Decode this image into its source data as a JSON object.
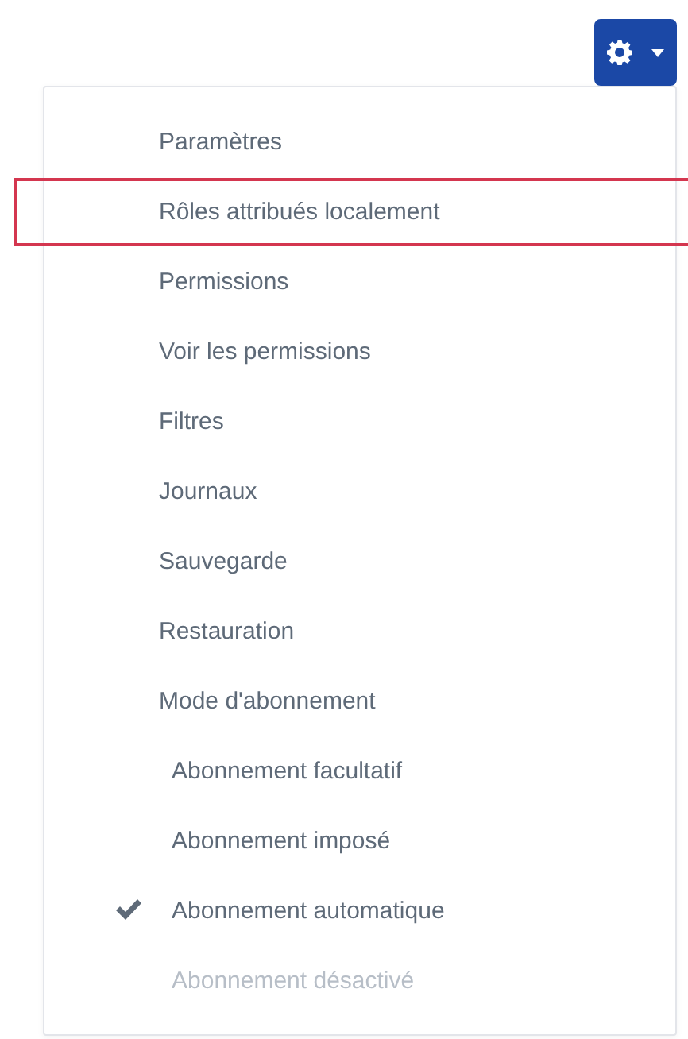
{
  "menu": {
    "items": [
      {
        "label": "Paramètres",
        "highlighted": false
      },
      {
        "label": "Rôles attribués localement",
        "highlighted": true
      },
      {
        "label": "Permissions",
        "highlighted": false
      },
      {
        "label": "Voir les permissions",
        "highlighted": false
      },
      {
        "label": "Filtres",
        "highlighted": false
      },
      {
        "label": "Journaux",
        "highlighted": false
      },
      {
        "label": "Sauvegarde",
        "highlighted": false
      },
      {
        "label": "Restauration",
        "highlighted": false
      },
      {
        "label": "Mode d'abonnement",
        "highlighted": false,
        "children": [
          {
            "label": "Abonnement facultatif",
            "checked": false,
            "disabled": false
          },
          {
            "label": "Abonnement imposé",
            "checked": false,
            "disabled": false
          },
          {
            "label": "Abonnement automatique",
            "checked": true,
            "disabled": false
          },
          {
            "label": "Abonnement désactivé",
            "checked": false,
            "disabled": true
          }
        ]
      }
    ]
  }
}
